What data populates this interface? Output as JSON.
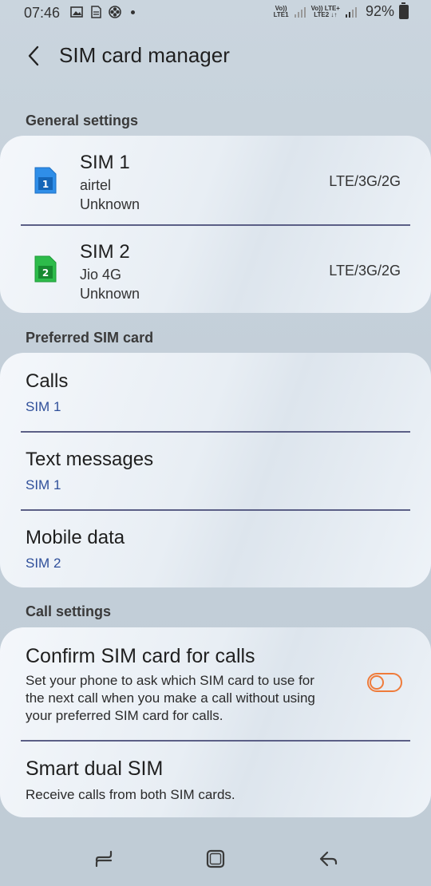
{
  "status_bar": {
    "time": "07:46",
    "sim1_net_top": "Vo))",
    "sim1_net_bottom": "LTE1",
    "sim2_net_top": "Vo)) LTE+",
    "sim2_net_bottom": "LTE2 ↓↑",
    "battery": "92%"
  },
  "header": {
    "title": "SIM card manager"
  },
  "general_settings": {
    "heading": "General settings",
    "sims": [
      {
        "number": "1",
        "name": "SIM 1",
        "carrier": "airtel",
        "status": "Unknown",
        "network": "LTE/3G/2G",
        "color": "#2f8ee8"
      },
      {
        "number": "2",
        "name": "SIM 2",
        "carrier": "Jio 4G",
        "status": "Unknown",
        "network": "LTE/3G/2G",
        "color": "#2dbb4a"
      }
    ]
  },
  "preferred_sim": {
    "heading": "Preferred SIM card",
    "items": [
      {
        "label": "Calls",
        "value": "SIM 1"
      },
      {
        "label": "Text messages",
        "value": "SIM 1"
      },
      {
        "label": "Mobile data",
        "value": "SIM 2"
      }
    ]
  },
  "call_settings": {
    "heading": "Call settings",
    "confirm": {
      "title": "Confirm SIM card for calls",
      "desc_line1": "Set your phone to ask which SIM card to use for",
      "desc_line2": "the next call when you make a call without using",
      "desc_line3": "your preferred SIM card for calls.",
      "enabled": false,
      "toggle_color": "#ef7b3a"
    },
    "smart_dual": {
      "title": "Smart dual SIM",
      "desc": "Receive calls from both SIM cards."
    }
  },
  "nav": {
    "recents_icon": "recents-icon",
    "home_icon": "home-icon",
    "back_icon": "back-arrow-icon"
  }
}
